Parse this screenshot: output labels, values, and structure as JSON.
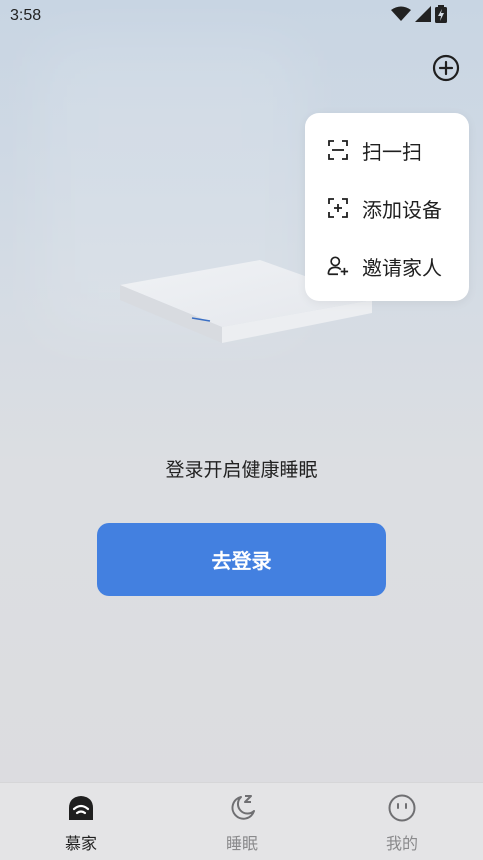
{
  "status_bar": {
    "time": "3:58",
    "icons": [
      "wifi-icon",
      "signal-icon",
      "battery-icon"
    ]
  },
  "header": {
    "add_icon": "plus-circle-icon"
  },
  "popup_menu": {
    "items": [
      {
        "icon": "scan-icon",
        "label": "扫一扫"
      },
      {
        "icon": "add-device-icon",
        "label": "添加设备"
      },
      {
        "icon": "invite-user-icon",
        "label": "邀请家人"
      }
    ]
  },
  "main": {
    "prompt": "登录开启健康睡眠",
    "login_label": "去登录"
  },
  "tab_bar": {
    "items": [
      {
        "icon": "home-icon",
        "label": "慕家",
        "active": true
      },
      {
        "icon": "moon-sleep-icon",
        "label": "睡眠",
        "active": false
      },
      {
        "icon": "smiley-icon",
        "label": "我的",
        "active": false
      }
    ]
  },
  "colors": {
    "accent": "#4380e0",
    "active_tab": "#1f1f1f",
    "inactive_tab": "#8a8a8c"
  }
}
